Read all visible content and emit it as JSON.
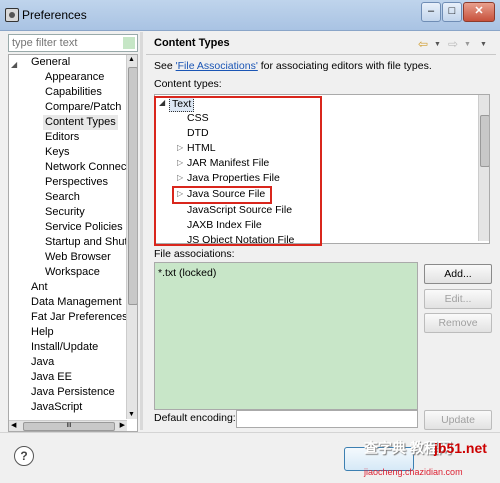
{
  "window": {
    "title": "Preferences",
    "buttons": [
      "–",
      "□",
      "✕"
    ]
  },
  "left": {
    "filter_placeholder": "type filter text",
    "tree_items": [
      {
        "label": "General"
      },
      {
        "label": "Appearance"
      },
      {
        "label": "Capabilities"
      },
      {
        "label": "Compare/Patch"
      },
      {
        "label": "Content Types"
      },
      {
        "label": "Editors"
      },
      {
        "label": "Keys"
      },
      {
        "label": "Network Connectio"
      },
      {
        "label": "Perspectives"
      },
      {
        "label": "Search"
      },
      {
        "label": "Security"
      },
      {
        "label": "Service Policies"
      },
      {
        "label": "Startup and Shutd"
      },
      {
        "label": "Web Browser"
      },
      {
        "label": "Workspace"
      },
      {
        "label": "Ant"
      },
      {
        "label": "Data Management"
      },
      {
        "label": "Fat Jar Preferences"
      },
      {
        "label": "Help"
      },
      {
        "label": "Install/Update"
      },
      {
        "label": "Java"
      },
      {
        "label": "Java EE"
      },
      {
        "label": "Java Persistence"
      },
      {
        "label": "JavaScript"
      }
    ],
    "hscroll_mark": "III"
  },
  "right": {
    "title": "Content Types",
    "see_prefix": "See ",
    "see_link": "'File Associations'",
    "see_suffix": " for associating editors with file types.",
    "content_types_label": "Content types:",
    "content_types": [
      {
        "label": "Text"
      },
      {
        "label": "CSS"
      },
      {
        "label": "DTD"
      },
      {
        "label": "HTML"
      },
      {
        "label": "JAR Manifest File"
      },
      {
        "label": "Java Properties File"
      },
      {
        "label": "Java Source File"
      },
      {
        "label": "JavaScript Source File"
      },
      {
        "label": "JAXB Index File"
      },
      {
        "label": "JS Object Notation File"
      }
    ],
    "file_assoc_label": "File associations:",
    "file_assoc_items": [
      "*.txt (locked)"
    ],
    "buttons": {
      "add": "Add...",
      "edit": "Edit...",
      "remove": "Remove",
      "update": "Update"
    },
    "default_encoding_label": "Default encoding:",
    "default_encoding_value": ""
  },
  "bottom": {
    "help": "?"
  },
  "watermark": {
    "line1": "查字典 教程网",
    "line2": "jiaocheng.chazidian.com",
    "site": "jb51.net"
  },
  "colors": {
    "association_bg": "#c8e6c8",
    "highlight_box": "#d9261c",
    "link": "#1a55b5"
  }
}
